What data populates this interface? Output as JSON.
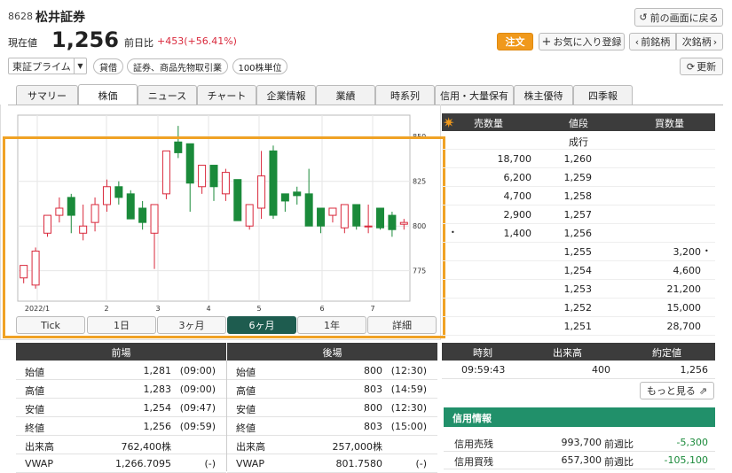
{
  "header": {
    "code": "8628",
    "name": "松井証券",
    "back_label": "前の画面に戻る",
    "price_label": "現在値",
    "price": "1,256",
    "change_label": "前日比",
    "change": "+453(+56.41%)",
    "order_label": "注文",
    "favorite_label": "お気に入り登録",
    "prev_label": "前銘柄",
    "next_label": "次銘柄",
    "market": "東証プライム",
    "tags": [
      "貸借",
      "証券、商品先物取引業",
      "100株単位"
    ],
    "refresh_label": "更新"
  },
  "tabs": [
    "サマリー",
    "株価",
    "ニュース",
    "チャート",
    "企業情報",
    "業績",
    "時系列",
    "信用・大量保有",
    "株主優待",
    "四季報"
  ],
  "active_tab": 1,
  "chart_data": {
    "type": "candlestick",
    "x_ticks": [
      "2022/1",
      "2",
      "3",
      "4",
      "5",
      "6",
      "7"
    ],
    "y_ticks": [
      "850",
      "825",
      "800",
      "775"
    ],
    "ylim": [
      758,
      862
    ],
    "candles": [
      {
        "o": 771,
        "h": 778,
        "l": 768,
        "c": 778
      },
      {
        "o": 767,
        "h": 788,
        "l": 765,
        "c": 786
      },
      {
        "o": 796,
        "h": 806,
        "l": 794,
        "c": 806
      },
      {
        "o": 806,
        "h": 816,
        "l": 802,
        "c": 810
      },
      {
        "o": 816,
        "h": 818,
        "l": 796,
        "c": 806
      },
      {
        "o": 796,
        "h": 812,
        "l": 792,
        "c": 800
      },
      {
        "o": 802,
        "h": 816,
        "l": 797,
        "c": 812
      },
      {
        "o": 812,
        "h": 826,
        "l": 808,
        "c": 822
      },
      {
        "o": 822,
        "h": 825,
        "l": 812,
        "c": 816
      },
      {
        "o": 818,
        "h": 820,
        "l": 804,
        "c": 804
      },
      {
        "o": 810,
        "h": 814,
        "l": 798,
        "c": 802
      },
      {
        "o": 796,
        "h": 812,
        "l": 776,
        "c": 812
      },
      {
        "o": 818,
        "h": 842,
        "l": 815,
        "c": 842
      },
      {
        "o": 847,
        "h": 856,
        "l": 838,
        "c": 841
      },
      {
        "o": 846,
        "h": 846,
        "l": 808,
        "c": 824
      },
      {
        "o": 822,
        "h": 834,
        "l": 818,
        "c": 834
      },
      {
        "o": 834,
        "h": 834,
        "l": 814,
        "c": 822
      },
      {
        "o": 818,
        "h": 832,
        "l": 814,
        "c": 830
      },
      {
        "o": 826,
        "h": 826,
        "l": 803,
        "c": 803
      },
      {
        "o": 800,
        "h": 812,
        "l": 798,
        "c": 812
      },
      {
        "o": 810,
        "h": 842,
        "l": 804,
        "c": 828
      },
      {
        "o": 842,
        "h": 845,
        "l": 804,
        "c": 806
      },
      {
        "o": 818,
        "h": 818,
        "l": 808,
        "c": 814
      },
      {
        "o": 819,
        "h": 822,
        "l": 812,
        "c": 817
      },
      {
        "o": 818,
        "h": 832,
        "l": 800,
        "c": 800
      },
      {
        "o": 810,
        "h": 810,
        "l": 796,
        "c": 800
      },
      {
        "o": 806,
        "h": 810,
        "l": 802,
        "c": 810
      },
      {
        "o": 799,
        "h": 812,
        "l": 796,
        "c": 812
      },
      {
        "o": 812,
        "h": 812,
        "l": 798,
        "c": 800
      },
      {
        "o": 800,
        "h": 812,
        "l": 796,
        "c": 800
      },
      {
        "o": 810,
        "h": 810,
        "l": 798,
        "c": 799
      },
      {
        "o": 806,
        "h": 808,
        "l": 794,
        "c": 798
      },
      {
        "o": 801,
        "h": 804,
        "l": 798,
        "c": 802
      }
    ]
  },
  "period_buttons": [
    "Tick",
    "1日",
    "3ヶ月",
    "6ヶ月",
    "1年",
    "詳細"
  ],
  "active_period": 3,
  "order_book": {
    "headers": [
      "売数量",
      "値段",
      "買数量"
    ],
    "rows": [
      {
        "sell": "",
        "price": "成行",
        "buy": ""
      },
      {
        "sell": "18,700",
        "price": "1,260",
        "buy": ""
      },
      {
        "sell": "6,200",
        "price": "1,259",
        "buy": ""
      },
      {
        "sell": "4,700",
        "price": "1,258",
        "buy": ""
      },
      {
        "sell": "2,900",
        "price": "1,257",
        "buy": ""
      },
      {
        "sell": "1,400",
        "price": "1,256",
        "buy": ""
      },
      {
        "sell": "",
        "price": "1,255",
        "buy": "3,200"
      },
      {
        "sell": "",
        "price": "1,254",
        "buy": "4,600"
      },
      {
        "sell": "",
        "price": "1,253",
        "buy": "21,200"
      },
      {
        "sell": "",
        "price": "1,252",
        "buy": "15,000"
      },
      {
        "sell": "",
        "price": "1,251",
        "buy": "28,700"
      }
    ]
  },
  "session_am": {
    "title": "前場",
    "rows": [
      {
        "label": "始値",
        "value": "1,281",
        "time": "(09:00)"
      },
      {
        "label": "高値",
        "value": "1,283",
        "time": "(09:00)"
      },
      {
        "label": "安値",
        "value": "1,254",
        "time": "(09:47)"
      },
      {
        "label": "終値",
        "value": "1,256",
        "time": "(09:59)"
      },
      {
        "label": "出来高",
        "value": "762,400株",
        "time": ""
      },
      {
        "label": "VWAP",
        "value": "1,266.7095",
        "time": "(-)"
      }
    ]
  },
  "session_pm": {
    "title": "後場",
    "rows": [
      {
        "label": "始値",
        "value": "800",
        "time": "(12:30)"
      },
      {
        "label": "高値",
        "value": "803",
        "time": "(14:59)"
      },
      {
        "label": "安値",
        "value": "800",
        "time": "(12:30)"
      },
      {
        "label": "終値",
        "value": "803",
        "time": "(15:00)"
      },
      {
        "label": "出来高",
        "value": "257,000株",
        "time": ""
      },
      {
        "label": "VWAP",
        "value": "801.7580",
        "time": "(-)"
      }
    ]
  },
  "trades": {
    "headers": [
      "時刻",
      "出来高",
      "約定値"
    ],
    "rows": [
      {
        "time": "09:59:43",
        "volume": "400",
        "price": "1,256"
      }
    ],
    "more_label": "もっと見る"
  },
  "margin": {
    "title": "信用情報",
    "rows": [
      {
        "label": "信用売残",
        "value": "993,700",
        "cmp": "前週比",
        "diff": "-5,300"
      },
      {
        "label": "信用買残",
        "value": "657,300",
        "cmp": "前週比",
        "diff": "-105,100"
      }
    ]
  },
  "colors": {
    "up": "#d9283b",
    "down": "#1a8a3a",
    "accent": "#f0991c",
    "green_header": "#21906a",
    "dark_header": "#3c3c3c"
  }
}
